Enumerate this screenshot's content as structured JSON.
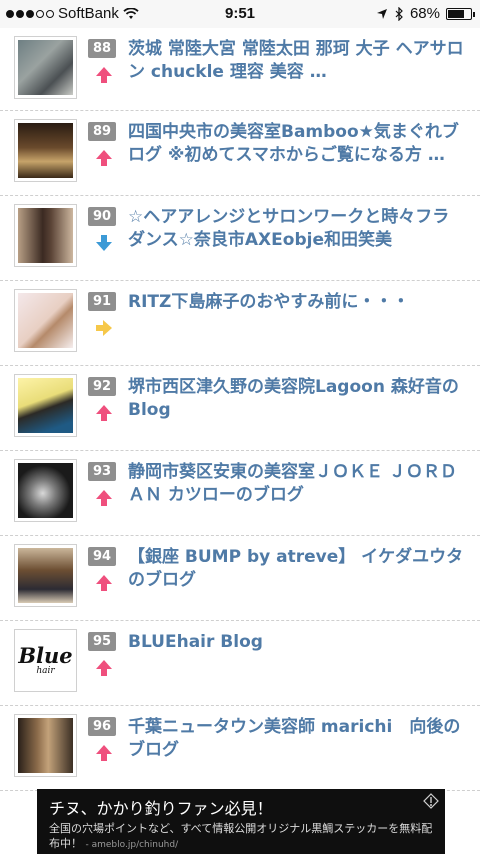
{
  "status_bar": {
    "carrier": "SoftBank",
    "time": "9:51",
    "battery": "68%",
    "signal_bars": 3
  },
  "ranking_list": [
    {
      "rank": "88",
      "trend": "up",
      "title": "茨城 常陸大宮 常陸太田 那珂 大子 ヘアサロン chuckle 理容 美容 …"
    },
    {
      "rank": "89",
      "trend": "up",
      "title": "四国中央市の美容室Bamboo★気まぐれブログ ※初めてスマホからご覧になる方 …"
    },
    {
      "rank": "90",
      "trend": "down",
      "title": "☆ヘアアレンジとサロンワークと時々フラダンス☆奈良市AXEobje和田笑美"
    },
    {
      "rank": "91",
      "trend": "same",
      "title": "RITZ下島麻子のおやすみ前に・・・"
    },
    {
      "rank": "92",
      "trend": "up",
      "title": "堺市西区津久野の美容院Lagoon 森好音のBlog"
    },
    {
      "rank": "93",
      "trend": "up",
      "title": "静岡市葵区安東の美容室ＪＯＫＥ ＪＯＲＤＡＮ カツローのブログ"
    },
    {
      "rank": "94",
      "trend": "up",
      "title": "【銀座 BUMP by atreve】 イケダユウタのブログ"
    },
    {
      "rank": "95",
      "trend": "up",
      "title": "BLUEhair Blog",
      "thumb_text": "Blue",
      "thumb_sub": "hair"
    },
    {
      "rank": "96",
      "trend": "up",
      "title": "千葉ニュータウン美容師 marichi　向後のブログ"
    }
  ],
  "ad": {
    "title": "チヌ、かかり釣りファン必見！",
    "text": "全国の穴場ポイントなど、すべて情報公開オリジナル黒鯛ステッカーを無料配布中！",
    "url": "- ameblo.jp/chinuhd/"
  },
  "colors": {
    "title_link": "#4f7aa6",
    "rank_badge": "#8f8f8f",
    "trend_up": "#ef4f7d",
    "trend_down": "#3c9ad6",
    "trend_same": "#f6c84a"
  }
}
